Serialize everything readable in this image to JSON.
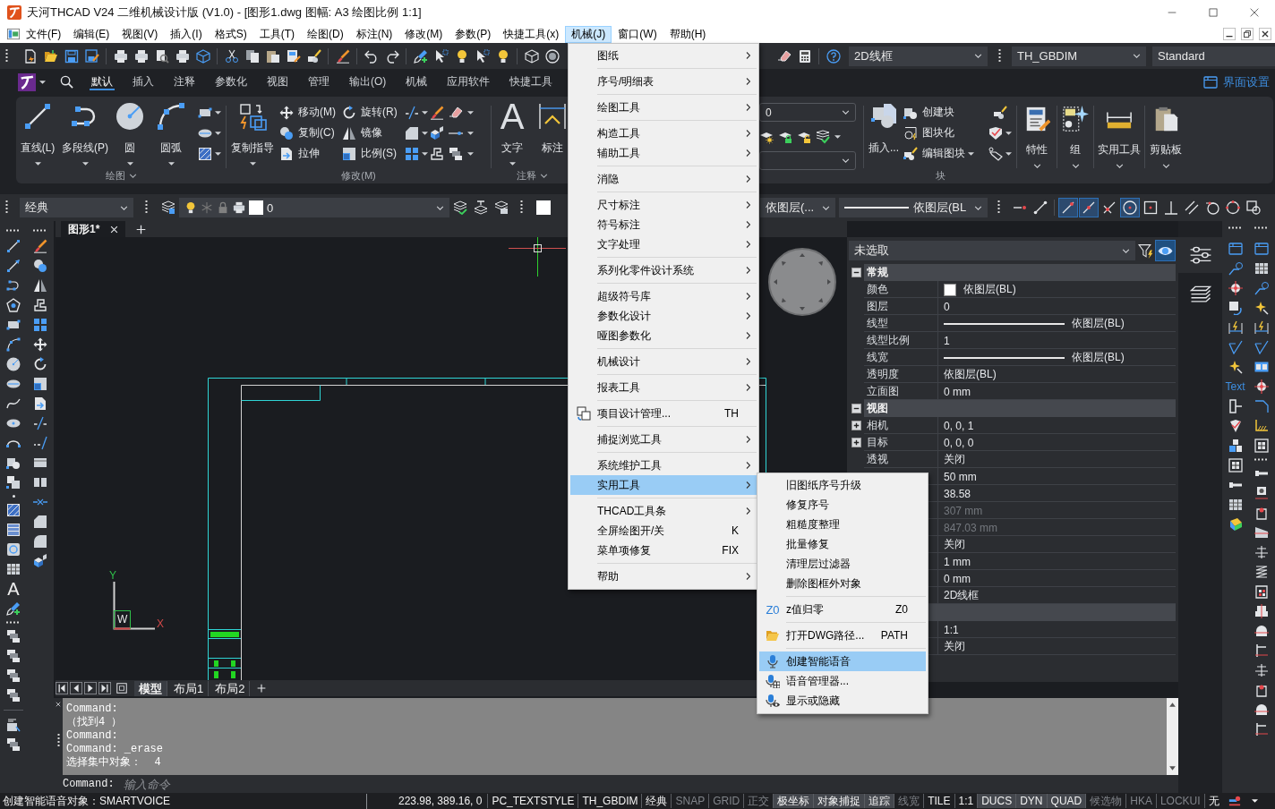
{
  "window": {
    "title": "天河THCAD V24 二维机械设计版 (V1.0) - [图形1.dwg 图幅: A3 绘图比例 1:1]"
  },
  "menu_bar": [
    {
      "label": "文件(F)",
      "selected": false
    },
    {
      "label": "编辑(E)",
      "selected": false
    },
    {
      "label": "视图(V)",
      "selected": false
    },
    {
      "label": "插入(I)",
      "selected": false
    },
    {
      "label": "格式S)",
      "selected": false
    },
    {
      "label": "工具(T)",
      "selected": false
    },
    {
      "label": "绘图(D)",
      "selected": false
    },
    {
      "label": "标注(N)",
      "selected": false
    },
    {
      "label": "修改(M)",
      "selected": false
    },
    {
      "label": "参数(P)",
      "selected": false
    },
    {
      "label": "快捷工具(x)",
      "selected": false
    },
    {
      "label": "机械(J)",
      "selected": true
    },
    {
      "label": "窗口(W)",
      "selected": false
    },
    {
      "label": "帮助(H)",
      "selected": false
    }
  ],
  "toolbar": {
    "visual_style": "2D线框",
    "dim_style": "TH_GBDIM",
    "text_style": "Standard"
  },
  "ribbon_tabs": [
    {
      "label": "默认",
      "selected": true
    },
    {
      "label": "插入",
      "selected": false
    },
    {
      "label": "注释",
      "selected": false
    },
    {
      "label": "参数化",
      "selected": false
    },
    {
      "label": "视图",
      "selected": false
    },
    {
      "label": "管理",
      "selected": false
    },
    {
      "label": "输出(O)",
      "selected": false
    },
    {
      "label": "机械",
      "selected": false
    },
    {
      "label": "应用软件",
      "selected": false
    },
    {
      "label": "快捷工具",
      "selected": false
    }
  ],
  "ribbon_settings": "界面设置",
  "ribbon": {
    "draw": {
      "title": "绘图",
      "buttons": [
        "直线(L)",
        "多段线(P)",
        "圆",
        "圆弧"
      ]
    },
    "modify": {
      "title": "修改(M)",
      "guide": "复制指导",
      "tools": [
        "移动(M)",
        "旋转(R)",
        "复制(C)",
        "镜像",
        "拉伸",
        "比例(S)"
      ]
    },
    "annotation": {
      "title": "注释",
      "text_glyph": "A",
      "text_label": "文字",
      "dim_label": "标注"
    },
    "layer": {
      "value": "0"
    },
    "block": {
      "title": "块",
      "insert": "插入...",
      "tools": [
        "创建块",
        "图块化",
        "编辑图块"
      ]
    },
    "panels": [
      "特性",
      "组",
      "实用工具",
      "剪贴板"
    ]
  },
  "layer_bar": {
    "workspace": "经典",
    "layer": "0",
    "color_control": "依图层(...",
    "linetype": "依图层(BL",
    "object_snaps": [
      {
        "on": true
      },
      {
        "on": true
      },
      {
        "on": false
      },
      {
        "on": true
      },
      {
        "on": false
      },
      {
        "on": false
      },
      {
        "on": false
      },
      {
        "on": false
      },
      {
        "on": false
      },
      {
        "on": false
      }
    ]
  },
  "left_toolbar": {
    "text_glyph": "A"
  },
  "drawing_tabs": [
    {
      "label": "图形1*",
      "selected": true
    }
  ],
  "canvas": {
    "axis_y": "Y",
    "axis_x": "X",
    "ucs_label": "W"
  },
  "layout_tabs": [
    {
      "label": "模型",
      "selected": true
    },
    {
      "label": "布局1",
      "selected": false
    },
    {
      "label": "布局2",
      "selected": false
    }
  ],
  "properties": {
    "selection": "未选取",
    "preview_on": true,
    "sections": [
      {
        "title": "常规",
        "expanded": true,
        "rows": [
          {
            "label": "颜色",
            "value": "依图层(BL)",
            "kind": "swatch",
            "expandable": false,
            "disabled": false
          },
          {
            "label": "图层",
            "value": "0",
            "kind": "text",
            "expandable": false,
            "disabled": false
          },
          {
            "label": "线型",
            "value": "依图层(BL)",
            "kind": "line",
            "expandable": false,
            "disabled": false
          },
          {
            "label": "线型比例",
            "value": "1",
            "kind": "text",
            "expandable": false,
            "disabled": false
          },
          {
            "label": "线宽",
            "value": "依图层(BL)",
            "kind": "line",
            "expandable": false,
            "disabled": false
          },
          {
            "label": "透明度",
            "value": "依图层(BL)",
            "kind": "text",
            "expandable": false,
            "disabled": false
          },
          {
            "label": "立面图",
            "value": "0 mm",
            "kind": "text",
            "expandable": false,
            "disabled": false
          }
        ]
      },
      {
        "title": "视图",
        "expanded": true,
        "rows": [
          {
            "label": "相机",
            "value": "0, 0, 1",
            "kind": "text",
            "expandable": true,
            "disabled": false
          },
          {
            "label": "目标",
            "value": "0, 0, 0",
            "kind": "text",
            "expandable": true,
            "disabled": false
          },
          {
            "label": "透视",
            "value": "关闭",
            "kind": "text",
            "expandable": false,
            "disabled": false
          },
          {
            "value": "50 mm",
            "kind": "text",
            "expandable": false,
            "disabled": false
          },
          {
            "value": "38.58",
            "kind": "text",
            "expandable": false,
            "disabled": false
          },
          {
            "value": "307 mm",
            "kind": "text",
            "expandable": false,
            "disabled": true
          },
          {
            "value": "847.03 mm",
            "kind": "text",
            "expandable": false,
            "disabled": true
          },
          {
            "value": "关闭",
            "kind": "text",
            "expandable": false,
            "disabled": false
          },
          {
            "value": "1 mm",
            "kind": "text",
            "expandable": false,
            "disabled": false
          },
          {
            "value": "0 mm",
            "kind": "text",
            "expandable": false,
            "disabled": false
          },
          {
            "value": "2D线框",
            "kind": "text",
            "expandable": false,
            "disabled": false
          }
        ]
      },
      {
        "rows": [
          {
            "value": "1:1",
            "kind": "text",
            "expandable": false,
            "disabled": false
          },
          {
            "value": "关闭",
            "kind": "text",
            "expandable": false,
            "disabled": false
          }
        ]
      }
    ]
  },
  "right_toolbar": {
    "text_tool": "Text"
  },
  "command_history": [
    "Command:",
    "（找到4 ）",
    "Command:",
    "Command: _erase",
    "选择集中对象：  4"
  ],
  "command_line": {
    "prompt": "Command:",
    "placeholder": "输入命令"
  },
  "status_bar": {
    "message": "创建智能语音对象：SMARTVOICE",
    "coordinates": "223.98, 389.16, 0",
    "items": [
      {
        "label": "PC_TEXTSTYLE",
        "kind": "text"
      },
      {
        "label": "TH_GBDIM",
        "kind": "text"
      },
      {
        "label": "经典",
        "kind": "text"
      },
      {
        "label": "SNAP",
        "kind": "toggle",
        "on": false
      },
      {
        "label": "GRID",
        "kind": "toggle",
        "on": false
      },
      {
        "label": "正交",
        "kind": "toggle",
        "on": false
      },
      {
        "label": "极坐标",
        "kind": "toggle",
        "on": true
      },
      {
        "label": "对象捕捉",
        "kind": "toggle",
        "on": true
      },
      {
        "label": "追踪",
        "kind": "toggle",
        "on": true
      },
      {
        "label": "线宽",
        "kind": "toggle",
        "on": false
      },
      {
        "label": "TILE",
        "kind": "text"
      },
      {
        "label": "1:1",
        "kind": "text"
      },
      {
        "label": "DUCS",
        "kind": "toggle",
        "on": true
      },
      {
        "label": "DYN",
        "kind": "toggle",
        "on": true
      },
      {
        "label": "QUAD",
        "kind": "toggle",
        "on": true
      },
      {
        "label": "候选物",
        "kind": "toggle",
        "on": false
      },
      {
        "label": "HKA",
        "kind": "toggle",
        "on": false
      },
      {
        "label": "LOCKUI",
        "kind": "toggle",
        "on": false
      },
      {
        "label": "无",
        "kind": "text"
      }
    ]
  },
  "menu": {
    "items": [
      {
        "kind": "submenu",
        "label": "图纸",
        "selected": false
      },
      {
        "kind": "separator"
      },
      {
        "kind": "submenu",
        "label": "序号/明细表",
        "selected": false
      },
      {
        "kind": "separator"
      },
      {
        "kind": "submenu",
        "label": "绘图工具",
        "selected": false
      },
      {
        "kind": "separator"
      },
      {
        "kind": "submenu",
        "label": "构造工具",
        "selected": false
      },
      {
        "kind": "submenu",
        "label": "辅助工具",
        "selected": false
      },
      {
        "kind": "separator"
      },
      {
        "kind": "submenu",
        "label": "消隐",
        "selected": false
      },
      {
        "kind": "separator"
      },
      {
        "kind": "submenu",
        "label": "尺寸标注",
        "selected": false
      },
      {
        "kind": "submenu",
        "label": "符号标注",
        "selected": false
      },
      {
        "kind": "submenu",
        "label": "文字处理",
        "selected": false
      },
      {
        "kind": "separator"
      },
      {
        "kind": "submenu",
        "label": "系列化零件设计系统",
        "selected": false
      },
      {
        "kind": "separator"
      },
      {
        "kind": "submenu",
        "label": "超级符号库",
        "selected": false
      },
      {
        "kind": "submenu",
        "label": "参数化设计",
        "selected": false
      },
      {
        "kind": "submenu",
        "label": "哑图参数化",
        "selected": false
      },
      {
        "kind": "separator"
      },
      {
        "kind": "submenu",
        "label": "机械设计",
        "selected": false
      },
      {
        "kind": "separator"
      },
      {
        "kind": "submenu",
        "label": "报表工具",
        "selected": false
      },
      {
        "kind": "separator"
      },
      {
        "kind": "command",
        "label": "项目设计管理...",
        "shortcut": "TH",
        "selected": false
      },
      {
        "kind": "separator"
      },
      {
        "kind": "submenu",
        "label": "捕捉浏览工具",
        "selected": false
      },
      {
        "kind": "separator"
      },
      {
        "kind": "submenu",
        "label": "系统维护工具",
        "selected": false
      },
      {
        "kind": "submenu",
        "label": "实用工具",
        "selected": true
      },
      {
        "kind": "separator"
      },
      {
        "kind": "submenu",
        "label": "THCAD工具条",
        "selected": false
      },
      {
        "kind": "command",
        "label": "全屏绘图开/关",
        "shortcut": "K",
        "selected": false
      },
      {
        "kind": "command",
        "label": "菜单项修复",
        "shortcut": "FIX",
        "selected": false
      },
      {
        "kind": "separator"
      },
      {
        "kind": "submenu",
        "label": "帮助",
        "selected": false
      }
    ]
  },
  "submenu": {
    "items": [
      {
        "kind": "command",
        "label": "旧图纸序号升级",
        "selected": false
      },
      {
        "kind": "command",
        "label": "修复序号",
        "selected": false
      },
      {
        "kind": "command",
        "label": "粗糙度整理",
        "selected": false
      },
      {
        "kind": "command",
        "label": "批量修复",
        "selected": false
      },
      {
        "kind": "command",
        "label": "清理层过滤器",
        "selected": false
      },
      {
        "kind": "command",
        "label": "删除图框外对象",
        "selected": false
      },
      {
        "kind": "separator"
      },
      {
        "kind": "command",
        "label": "z值归零",
        "shortcut": "Z0",
        "icon_text": "Z0",
        "selected": false
      },
      {
        "kind": "separator"
      },
      {
        "kind": "command",
        "label": "打开DWG路径...",
        "shortcut": "PATH",
        "selected": false
      },
      {
        "kind": "separator"
      },
      {
        "kind": "command",
        "label": "创建智能语音",
        "selected": true
      },
      {
        "kind": "command",
        "label": "语音管理器...",
        "selected": false
      },
      {
        "kind": "command",
        "label": "显示或隐藏",
        "selected": false
      }
    ]
  }
}
